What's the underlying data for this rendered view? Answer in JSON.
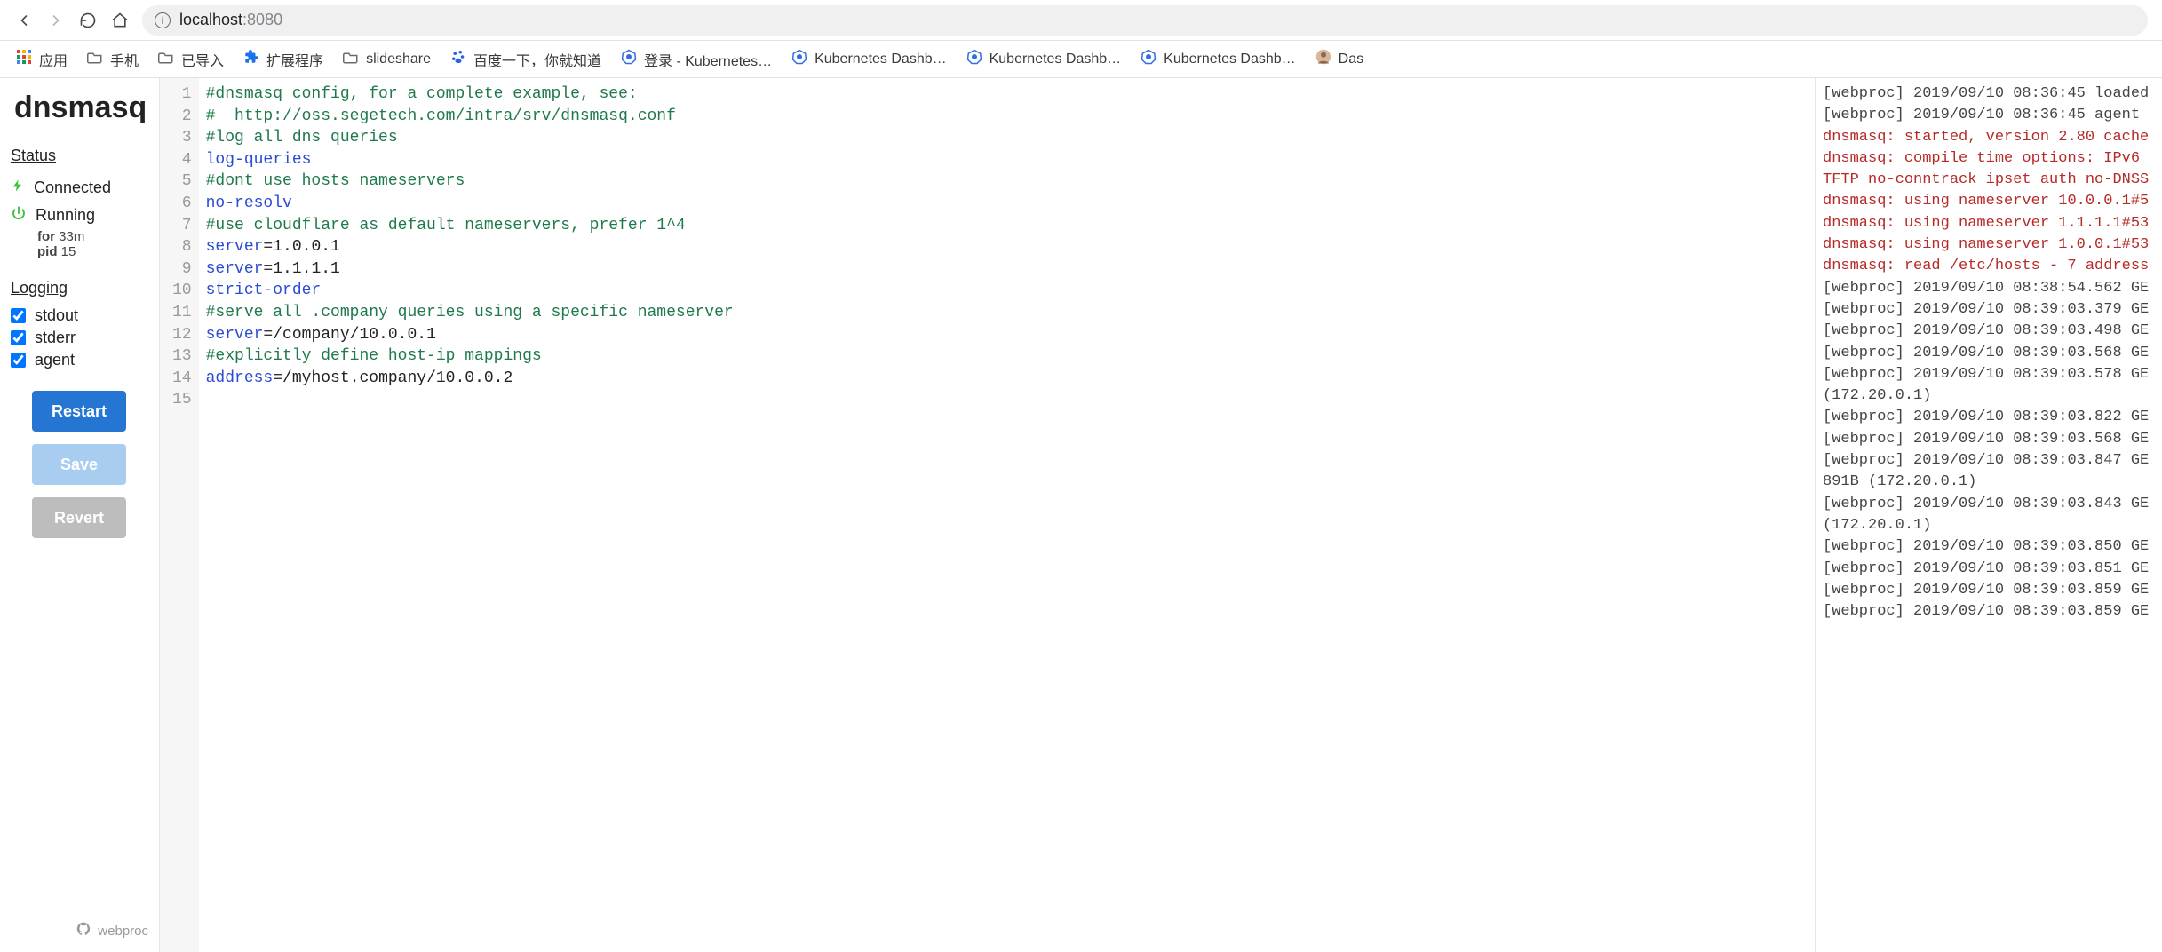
{
  "chrome": {
    "url_host": "localhost",
    "url_port": ":8080",
    "bookmarks": [
      {
        "kind": "apps",
        "label": "应用"
      },
      {
        "kind": "folder",
        "label": "手机"
      },
      {
        "kind": "folder",
        "label": "已导入"
      },
      {
        "kind": "ext",
        "label": "扩展程序"
      },
      {
        "kind": "folder",
        "label": "slideshare"
      },
      {
        "kind": "baidu",
        "label": "百度一下，你就知道"
      },
      {
        "kind": "kube",
        "label": "登录 - Kubernetes…"
      },
      {
        "kind": "kube",
        "label": "Kubernetes Dashb…"
      },
      {
        "kind": "kube",
        "label": "Kubernetes Dashb…"
      },
      {
        "kind": "kube",
        "label": "Kubernetes Dashb…"
      },
      {
        "kind": "avatar",
        "label": "Das"
      }
    ]
  },
  "sidebar": {
    "title": "dnsmasq",
    "status_heading": "Status",
    "connected_label": "Connected",
    "running_label": "Running",
    "for_prefix": "for",
    "for_value": "33m",
    "pid_prefix": "pid",
    "pid_value": "15",
    "logging_heading": "Logging",
    "checks": {
      "stdout": "stdout",
      "stderr": "stderr",
      "agent": "agent"
    },
    "buttons": {
      "restart": "Restart",
      "save": "Save",
      "revert": "Revert"
    },
    "footer_label": "webproc"
  },
  "editor": {
    "lines": [
      {
        "type": "comment",
        "text": "#dnsmasq config, for a complete example, see:"
      },
      {
        "type": "comment",
        "text": "#  http://oss.segetech.com/intra/srv/dnsmasq.conf"
      },
      {
        "type": "comment",
        "text": "#log all dns queries"
      },
      {
        "type": "key",
        "key": "log-queries",
        "val": null
      },
      {
        "type": "comment",
        "text": "#dont use hosts nameservers"
      },
      {
        "type": "key",
        "key": "no-resolv",
        "val": null
      },
      {
        "type": "comment",
        "text": "#use cloudflare as default nameservers, prefer 1^4"
      },
      {
        "type": "kv",
        "key": "server",
        "val": "1.0.0.1"
      },
      {
        "type": "kv",
        "key": "server",
        "val": "1.1.1.1"
      },
      {
        "type": "key",
        "key": "strict-order",
        "val": null
      },
      {
        "type": "comment",
        "text": "#serve all .company queries using a specific nameserver"
      },
      {
        "type": "kv",
        "key": "server",
        "val": "/company/10.0.0.1"
      },
      {
        "type": "comment",
        "text": "#explicitly define host-ip mappings"
      },
      {
        "type": "kv",
        "key": "address",
        "val": "/myhost.company/10.0.0.2"
      },
      {
        "type": "blank",
        "text": ""
      }
    ]
  },
  "logs": {
    "lines": [
      {
        "cls": "normal",
        "text": "[webproc] 2019/09/10 08:36:45 loaded"
      },
      {
        "cls": "normal",
        "text": "[webproc] 2019/09/10 08:36:45 agent"
      },
      {
        "cls": "err",
        "text": "dnsmasq: started, version 2.80 cache"
      },
      {
        "cls": "err",
        "text": "dnsmasq: compile time options: IPv6"
      },
      {
        "cls": "err",
        "text": "TFTP no-conntrack ipset auth no-DNSS"
      },
      {
        "cls": "err",
        "text": "dnsmasq: using nameserver 10.0.0.1#5"
      },
      {
        "cls": "err",
        "text": "dnsmasq: using nameserver 1.1.1.1#53"
      },
      {
        "cls": "err",
        "text": "dnsmasq: using nameserver 1.0.0.1#53"
      },
      {
        "cls": "err",
        "text": "dnsmasq: read /etc/hosts - 7 address"
      },
      {
        "cls": "normal",
        "text": "[webproc] 2019/09/10 08:38:54.562 GE"
      },
      {
        "cls": "normal",
        "text": "[webproc] 2019/09/10 08:39:03.379 GE"
      },
      {
        "cls": "normal",
        "text": "[webproc] 2019/09/10 08:39:03.498 GE"
      },
      {
        "cls": "normal",
        "text": "[webproc] 2019/09/10 08:39:03.568 GE"
      },
      {
        "cls": "normal",
        "text": "[webproc] 2019/09/10 08:39:03.578 GE"
      },
      {
        "cls": "normal",
        "text": "(172.20.0.1)"
      },
      {
        "cls": "normal",
        "text": "[webproc] 2019/09/10 08:39:03.822 GE"
      },
      {
        "cls": "normal",
        "text": "[webproc] 2019/09/10 08:39:03.568 GE"
      },
      {
        "cls": "normal",
        "text": "[webproc] 2019/09/10 08:39:03.847 GE"
      },
      {
        "cls": "normal",
        "text": "891B (172.20.0.1)"
      },
      {
        "cls": "normal",
        "text": "[webproc] 2019/09/10 08:39:03.843 GE"
      },
      {
        "cls": "normal",
        "text": "(172.20.0.1)"
      },
      {
        "cls": "normal",
        "text": "[webproc] 2019/09/10 08:39:03.850 GE"
      },
      {
        "cls": "normal",
        "text": "[webproc] 2019/09/10 08:39:03.851 GE"
      },
      {
        "cls": "normal",
        "text": "[webproc] 2019/09/10 08:39:03.859 GE"
      },
      {
        "cls": "normal",
        "text": "[webproc] 2019/09/10 08:39:03.859 GE"
      }
    ]
  }
}
